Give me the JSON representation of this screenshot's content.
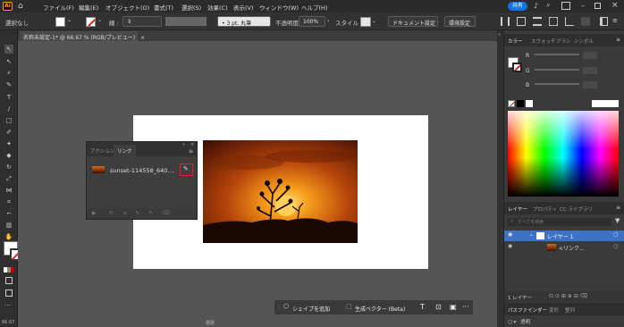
{
  "app": {
    "logo": "Ai"
  },
  "menu": [
    "ファイル(F)",
    "編集(E)",
    "オブジェクト(O)",
    "書式(T)",
    "選択(S)",
    "効果(C)",
    "表示(V)",
    "ウィンドウ(W)",
    "ヘルプ(H)"
  ],
  "share_label": "共有",
  "control": {
    "selection_label": "選択なし",
    "stroke_label": "線 :",
    "stroke_style": "3 pt. 丸筆",
    "opacity_label": "不透明度 :",
    "opacity_value": "100%",
    "style_label": "スタイル :",
    "doc_settings": "ドキュメント設定",
    "preferences": "環境設定"
  },
  "document": {
    "tab_title": "名称未設定-1* @ 66.67 % (RGB/プレビュー)",
    "close": "×"
  },
  "links_panel": {
    "tabs": [
      "アクション",
      "リンク"
    ],
    "item_name": "sunset-114558_640....",
    "menu_icon": "menu-icon"
  },
  "context_bar": {
    "add_shape": "シェイプを追加",
    "gen_vector": "生成ベクター (Beta)"
  },
  "color_panel": {
    "tabs": [
      "カラー",
      "スウォッチ",
      "ブラシ",
      "シンボル"
    ],
    "channels": [
      "R",
      "G",
      "B"
    ]
  },
  "layers_panel": {
    "tabs": [
      "レイヤー",
      "プロパティ",
      "CC ライブラリ"
    ],
    "search_placeholder": "すべてを検索",
    "layers": [
      {
        "name": "レイヤー 1"
      },
      {
        "name": "<リンク..."
      }
    ],
    "footer": "1 レイヤー"
  },
  "pathfinder_panel": {
    "tabs": [
      "パスファインダー",
      "変形",
      "整列"
    ],
    "opacity_value": "透明"
  },
  "status": {
    "zoom": "66.67",
    "tool": "選択"
  },
  "colors": {
    "accent": "#1473e6",
    "highlight_red": "#d9232b",
    "layer_blue": "#3d72c7"
  }
}
